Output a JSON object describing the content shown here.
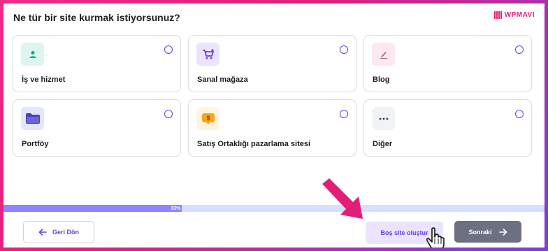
{
  "page": {
    "title": "Ne tür bir site kurmak istiyorsunuz?"
  },
  "brand": {
    "name": "WPMAVI"
  },
  "options": [
    {
      "label": "İş ve hizmet",
      "icon": "person-icon",
      "icon_bg": "#def4f0",
      "icon_color": "#00b090"
    },
    {
      "label": "Sanal mağaza",
      "icon": "cart-icon",
      "icon_bg": "#ebe4ff",
      "icon_color": "#673de6"
    },
    {
      "label": "Blog",
      "icon": "pen-icon",
      "icon_bg": "#ffe8ef",
      "icon_color": "#d63163"
    },
    {
      "label": "Portföy",
      "icon": "folder-icon",
      "icon_bg": "#e3e6ff",
      "icon_color": "#4a3fb5"
    },
    {
      "label": "Satış Ortaklığı pazarlama sitesi",
      "icon": "dollar-icon",
      "icon_bg": "#fff4e0",
      "icon_color": "#fea419"
    },
    {
      "label": "Diğer",
      "icon": "more-icon",
      "icon_bg": "#f2f3f6",
      "icon_color": "#36344d"
    }
  ],
  "progress": {
    "value": 0.33,
    "label": "33%"
  },
  "footer": {
    "back_label": "Geri Dön",
    "empty_label": "Boş site oluştur",
    "next_label": "Sonraki"
  },
  "colors": {
    "accent": "#673de6",
    "annotation": "#e31e78"
  }
}
